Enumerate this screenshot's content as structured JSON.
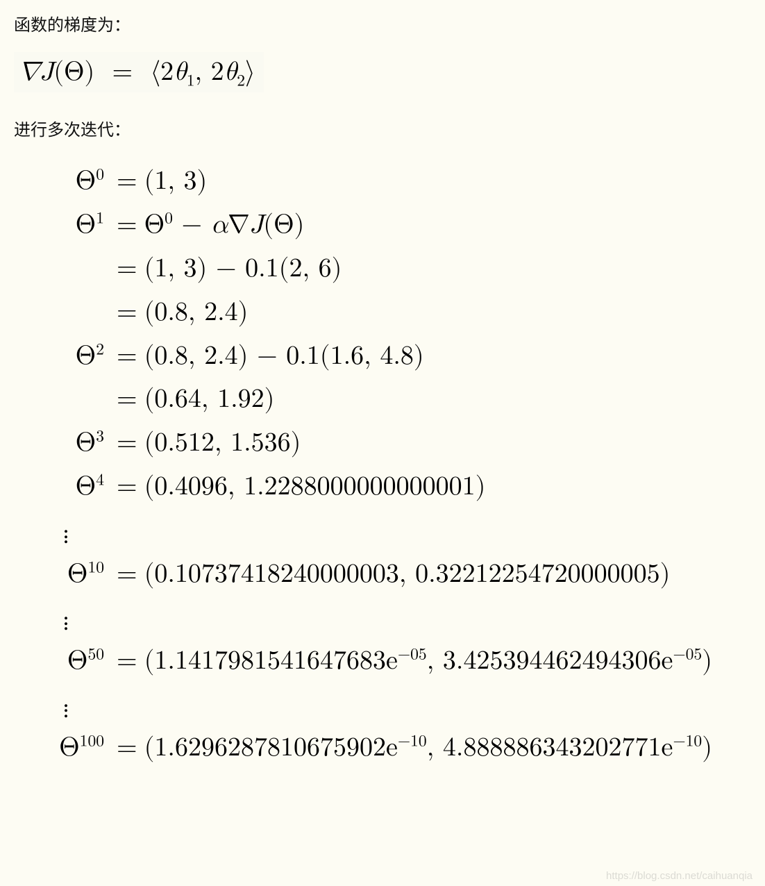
{
  "intro": {
    "gradient_label": "函数的梯度为：",
    "gradient_formula_lhs": "∇J(Θ)",
    "gradient_formula_rhs": "⟨2θ₁, 2θ₂⟩",
    "iterate_label": "进行多次迭代："
  },
  "iterations": {
    "theta0": {
      "sup": "0",
      "value": "(1, 3)"
    },
    "theta1_line1": {
      "sup": "1",
      "rhs": "Θ⁰ − α∇J(Θ)"
    },
    "theta1_line2": "(1, 3) − 0.1(2, 6)",
    "theta1_line3": "(0.8, 2.4)",
    "theta2_line1": {
      "sup": "2",
      "rhs": "(0.8, 2.4) − 0.1(1.6, 4.8)"
    },
    "theta2_line2": "(0.64, 1.92)",
    "theta3": {
      "sup": "3",
      "value": "(0.512, 1.536)"
    },
    "theta4": {
      "sup": "4",
      "value": "(0.4096, 1.2288000000000001)"
    },
    "theta10": {
      "sup": "10",
      "value": "(0.10737418240000003, 0.32212254720000005)"
    },
    "theta50": {
      "sup": "50",
      "v1": "1.1417981541647683e",
      "e1": "−05",
      "v2": "3.425394462494306e",
      "e2": "−05"
    },
    "theta100": {
      "sup": "100",
      "v1": "1.6296287810675902e",
      "e1": "−10",
      "v2": "4.888886343202771e",
      "e2": "−10"
    }
  },
  "symbols": {
    "Theta": "Θ",
    "equals": "=",
    "nabla": "∇",
    "alpha": "α",
    "lbrack": "(",
    "rbrack": ")",
    "comma": ", ",
    "langle": "⟨",
    "rangle": "⟩"
  },
  "watermark": "https://blog.csdn.net/caihuanqia"
}
